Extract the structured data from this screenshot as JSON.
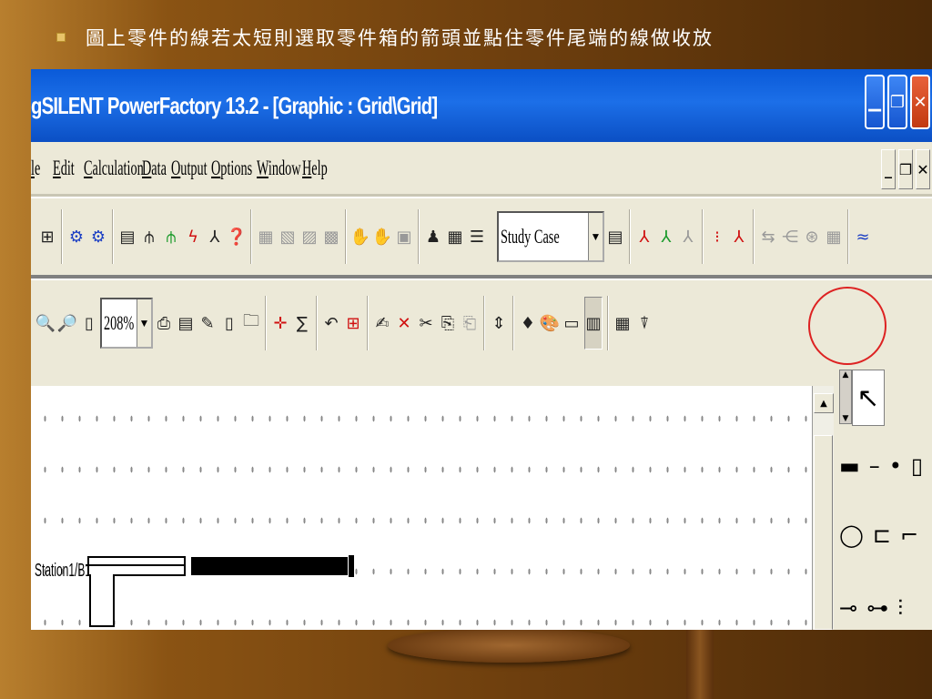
{
  "slide": {
    "caption": "圖上零件的線若太短則選取零件箱的箭頭並點住零件尾端的線做收放"
  },
  "window": {
    "title": "gSILENT PowerFactory 13.2 - [Graphic : Grid\\Grid]",
    "buttons": [
      "minimize",
      "maximize",
      "close"
    ]
  },
  "menubar": {
    "items": [
      "le",
      "Edit",
      "Calculation",
      "Data",
      "Output",
      "Options",
      "Window",
      "Help"
    ]
  },
  "toolbar": {
    "study_case": "Study Case"
  },
  "toolbar2": {
    "zoom": "208%"
  },
  "canvas": {
    "station_label": "Station1/B1"
  },
  "colors": {
    "titlebar": "#0a5ad8",
    "close_button": "#c23a10",
    "highlight_circle": "#d22222",
    "slide_background": "#8a5313"
  }
}
